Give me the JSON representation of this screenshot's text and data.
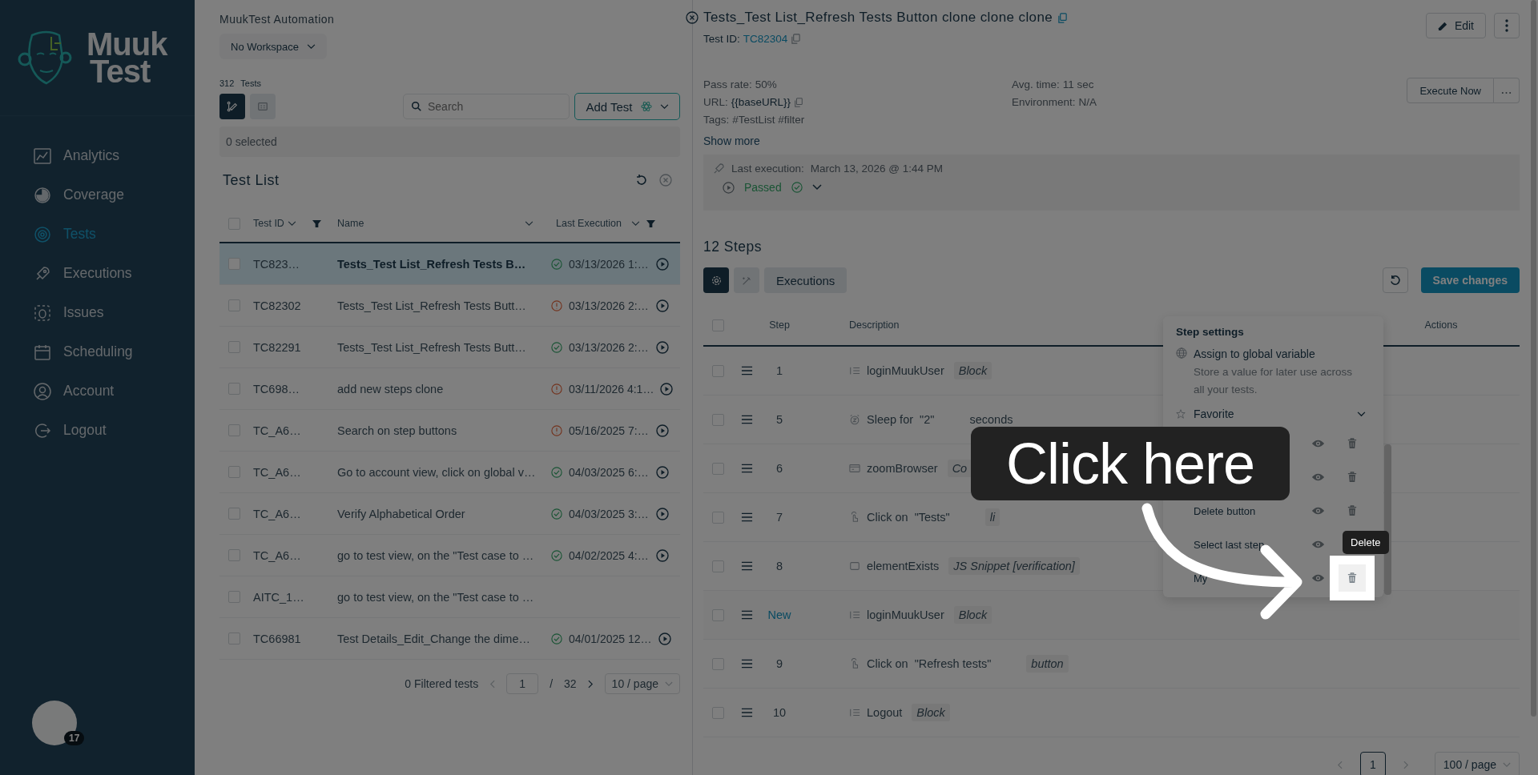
{
  "sidebar": {
    "logo": {
      "line1": "Muuk",
      "line2": "Test"
    },
    "items": [
      {
        "label": "Analytics",
        "kind": "analytics",
        "selected": false
      },
      {
        "label": "Coverage",
        "kind": "coverage",
        "selected": false
      },
      {
        "label": "Tests",
        "kind": "tests",
        "selected": true
      },
      {
        "label": "Executions",
        "kind": "executions",
        "selected": false
      },
      {
        "label": "Issues",
        "kind": "issues",
        "selected": false
      },
      {
        "label": "Scheduling",
        "kind": "scheduling",
        "selected": false
      },
      {
        "label": "Account",
        "kind": "account",
        "selected": false
      },
      {
        "label": "Logout",
        "kind": "logout",
        "selected": false
      }
    ],
    "avatar": {
      "badge": "17"
    }
  },
  "test_list": {
    "org": "MuukTest Automation",
    "workspace": "No Workspace",
    "count": "312",
    "count_label": "Tests",
    "views": [
      {
        "kind": "edit",
        "selected": true
      },
      {
        "kind": "grid",
        "selected": false
      }
    ],
    "search": {
      "placeholder": "Search"
    },
    "add_button": "Add Test",
    "selection": "0 selected",
    "title": "Test List",
    "all_checked": false,
    "columns": [
      {
        "label": "Test ID",
        "filter": true
      },
      {
        "label": "Name",
        "filter": false
      },
      {
        "label": "Last Execution",
        "filter": true
      }
    ],
    "rows": [
      {
        "id": "TC823…",
        "name": "Tests_Test List_Refresh Tests B…",
        "passed": true,
        "date": "03/13/2026 1:…",
        "selected": true,
        "checked": false
      },
      {
        "id": "TC82302",
        "name": "Tests_Test List_Refresh Tests Butt…",
        "passed": false,
        "date": "03/13/2026 2:…",
        "selected": false,
        "checked": false
      },
      {
        "id": "TC82291",
        "name": "Tests_Test List_Refresh Tests Butt…",
        "passed": true,
        "date": "03/13/2026 2:…",
        "selected": false,
        "checked": false
      },
      {
        "id": "TC698…",
        "name": "add new steps clone",
        "passed": false,
        "date": "03/11/2026 4:1…",
        "selected": false,
        "checked": false
      },
      {
        "id": "TC_A6…",
        "name": "Search on step buttons",
        "passed": false,
        "date": "05/16/2025 7:…",
        "selected": false,
        "checked": false
      },
      {
        "id": "TC_A6…",
        "name": "Go to account view, click on global v…",
        "passed": true,
        "date": "04/03/2025 6:…",
        "selected": false,
        "checked": false
      },
      {
        "id": "TC_A6…",
        "name": "Verify Alphabetical Order",
        "passed": true,
        "date": "04/03/2025 3:…",
        "selected": false,
        "checked": false
      },
      {
        "id": "TC_A6…",
        "name": "go to test view, on the \"Test case to …",
        "passed": true,
        "date": "04/02/2025 4:…",
        "selected": false,
        "checked": false
      },
      {
        "id": "AITC_1…",
        "name": "go to test view, on the \"Test case to …",
        "selected": false,
        "checked": false
      },
      {
        "id": "TC66981",
        "name": "Test Details_Edit_Change the dime…",
        "passed": true,
        "date": "04/01/2025 12…",
        "selected": false,
        "checked": false
      }
    ],
    "pager": {
      "filtered": "0 Filtered tests",
      "page": "1",
      "sep": "/",
      "total": "32",
      "per_page": "10 / page"
    }
  },
  "detail": {
    "title": "Tests_Test List_Refresh Tests Button clone clone clone",
    "id_label": "Test ID:",
    "id": "TC82304",
    "edit": "Edit",
    "execute": "Execute Now",
    "info_left": [
      {
        "label": "Pass rate:",
        "value": "50%",
        "copy": false
      },
      {
        "label": "URL:",
        "value": "{{baseURL}}",
        "copy": true
      },
      {
        "label": "Tags:",
        "value": "#TestList #filter",
        "copy": false
      }
    ],
    "info_right": [
      {
        "label": "Avg. time:",
        "value": "11 sec"
      },
      {
        "label": "Environment:",
        "value": "N/A"
      }
    ],
    "show_more": "Show more",
    "last_execution": {
      "label": "Last execution:",
      "date": "March 13, 2026 @ 1:44 PM",
      "passed": true,
      "status_label": "Passed"
    },
    "steps_title": "12 Steps",
    "tabs": [
      {
        "kind": "gear",
        "selected": true
      },
      {
        "kind": "wand",
        "selected": false
      },
      {
        "label": "Executions",
        "selected": false
      }
    ],
    "save": "Save changes",
    "all_checked": false,
    "columns": [
      "Step",
      "Description",
      "Actions"
    ],
    "steps": [
      {
        "number": "1",
        "kind": "block",
        "text": "loginMuukUser",
        "tag": "Block",
        "new": false,
        "checked": false
      },
      {
        "number": "5",
        "kind": "sleep",
        "text": "Sleep for  \"2\"",
        "suffix": "seconds",
        "new": false,
        "checked": false
      },
      {
        "number": "6",
        "kind": "browser",
        "text": "zoomBrowser",
        "tag": "Co",
        "new": false,
        "checked": false
      },
      {
        "number": "7",
        "kind": "click",
        "text": "Click on  \"Tests\"",
        "tag": "li",
        "new": false,
        "checked": false
      },
      {
        "number": "8",
        "kind": "check",
        "text": "elementExists",
        "tag": "JS Snippet [verification]",
        "new": false,
        "checked": false
      },
      {
        "number": "New",
        "kind": "block",
        "text": "loginMuukUser",
        "tag": "Block",
        "new": true,
        "checked": false
      },
      {
        "number": "9",
        "kind": "click",
        "text": "Click on  \"Refresh tests\"",
        "tag": "button",
        "new": false,
        "checked": false
      },
      {
        "number": "10",
        "kind": "block",
        "text": "Logout",
        "tag": "Block",
        "new": false,
        "checked": false
      }
    ],
    "pager": {
      "page": "1",
      "per_page": "100 / page"
    },
    "menu": {
      "title": "Step settings",
      "assign_title": "Assign to global variable",
      "assign_desc": "Store a value for later use across all your tests.",
      "section": "Favorite",
      "tooltip": "Delete",
      "items": [
        {
          "highlighted": false
        },
        {
          "highlighted": false
        },
        {
          "label": "Delete button",
          "highlighted": false
        },
        {
          "label": "Select last step",
          "highlighted": false
        },
        {
          "label": "My",
          "highlighted": true
        }
      ]
    }
  },
  "tutorial": {
    "callout": "Click here"
  }
}
